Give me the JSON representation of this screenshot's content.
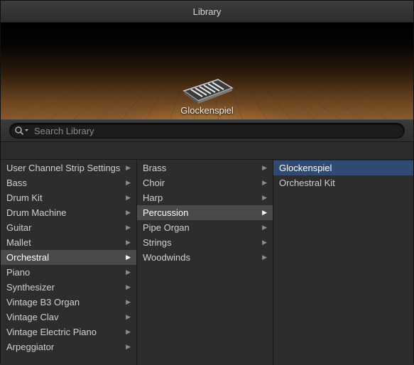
{
  "window": {
    "title": "Library"
  },
  "stage": {
    "instrument_name": "Glockenspiel",
    "instrument_icon": "glockenspiel-icon"
  },
  "search": {
    "placeholder": "Search Library",
    "icon": "search-icon"
  },
  "columns": {
    "categories": [
      {
        "label": "User Channel Strip Settings"
      },
      {
        "label": "Bass"
      },
      {
        "label": "Drum Kit"
      },
      {
        "label": "Drum Machine"
      },
      {
        "label": "Guitar"
      },
      {
        "label": "Mallet"
      },
      {
        "label": "Orchestral"
      },
      {
        "label": "Piano"
      },
      {
        "label": "Synthesizer"
      },
      {
        "label": "Vintage B3 Organ"
      },
      {
        "label": "Vintage Clav"
      },
      {
        "label": "Vintage Electric Piano"
      },
      {
        "label": "Arpeggiator"
      }
    ],
    "categories_selected": "Orchestral",
    "subcategories": [
      {
        "label": "Brass"
      },
      {
        "label": "Choir"
      },
      {
        "label": "Harp"
      },
      {
        "label": "Percussion"
      },
      {
        "label": "Pipe Organ"
      },
      {
        "label": "Strings"
      },
      {
        "label": "Woodwinds"
      }
    ],
    "subcategories_selected": "Percussion",
    "patches": [
      {
        "label": "Glockenspiel"
      },
      {
        "label": "Orchestral Kit"
      }
    ],
    "patches_selected": "Glockenspiel"
  },
  "colors": {
    "selection_blue": "#2f4b73",
    "selection_gray": "#4a4a4a"
  }
}
